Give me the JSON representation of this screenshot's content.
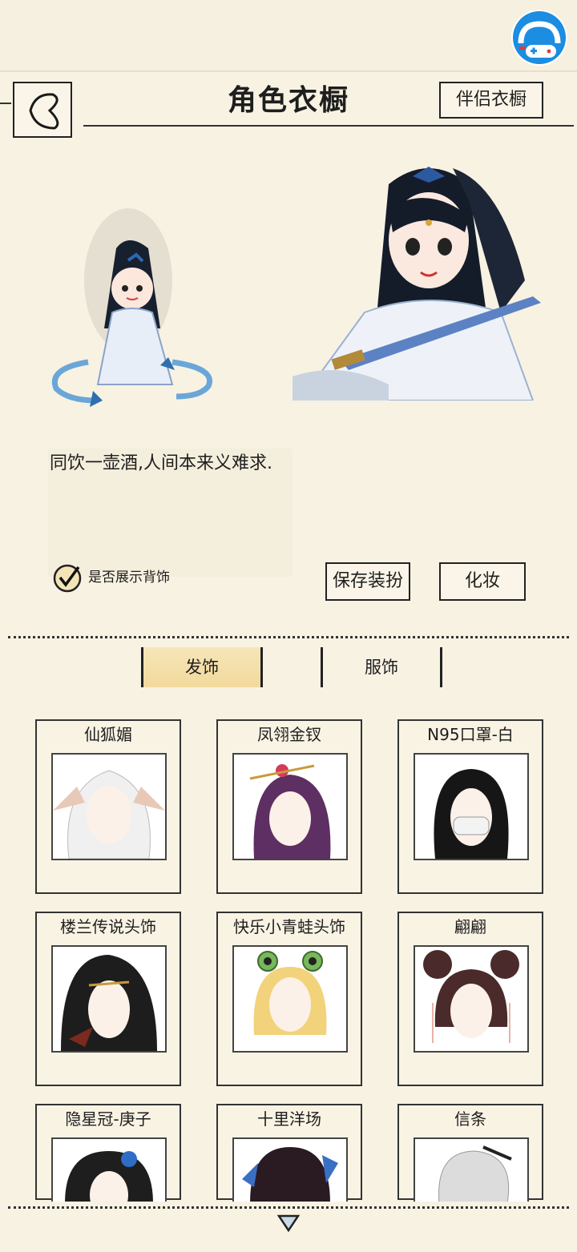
{
  "header": {
    "title": "角色衣橱",
    "companion_button": "伴侣衣橱"
  },
  "character": {
    "description": "同饮一壶酒,人间本来义难求.",
    "show_back_accessory_label": "是否展示背饰",
    "show_back_accessory_checked": true
  },
  "actions": {
    "save_label": "保存装扮",
    "makeup_label": "化妆"
  },
  "tabs": [
    {
      "label": "发饰",
      "active": true
    },
    {
      "label": "服饰",
      "active": false
    }
  ],
  "items": [
    {
      "name": "仙狐媚",
      "hair": "#f2f2f2",
      "icon": "fox-ear-hair-icon"
    },
    {
      "name": "凤翎金钗",
      "hair": "#5e2f63",
      "icon": "phoenix-hairpin-icon"
    },
    {
      "name": "N95口罩-白",
      "hair": "#161616",
      "icon": "mask-hair-icon"
    },
    {
      "name": "楼兰传说头饰",
      "hair": "#1d1d1d",
      "icon": "loulan-headdress-icon"
    },
    {
      "name": "快乐小青蛙头饰",
      "hair": "#f2d27a",
      "icon": "frog-headband-icon"
    },
    {
      "name": "翩翩",
      "hair": "#4a2a2a",
      "icon": "twin-buns-icon"
    },
    {
      "name": "隐星冠-庚子",
      "hair": "#1e1e1e",
      "icon": "star-crown-icon"
    },
    {
      "name": "十里洋场",
      "hair": "#2a1a22",
      "icon": "shanghai-hair-icon"
    },
    {
      "name": "信条",
      "hair": "#dcdcdc",
      "icon": "creed-hair-icon"
    }
  ],
  "colors": {
    "background": "#f8f2e3",
    "active_tab": "#f2d99c",
    "logo_blue": "#1c8de0"
  }
}
